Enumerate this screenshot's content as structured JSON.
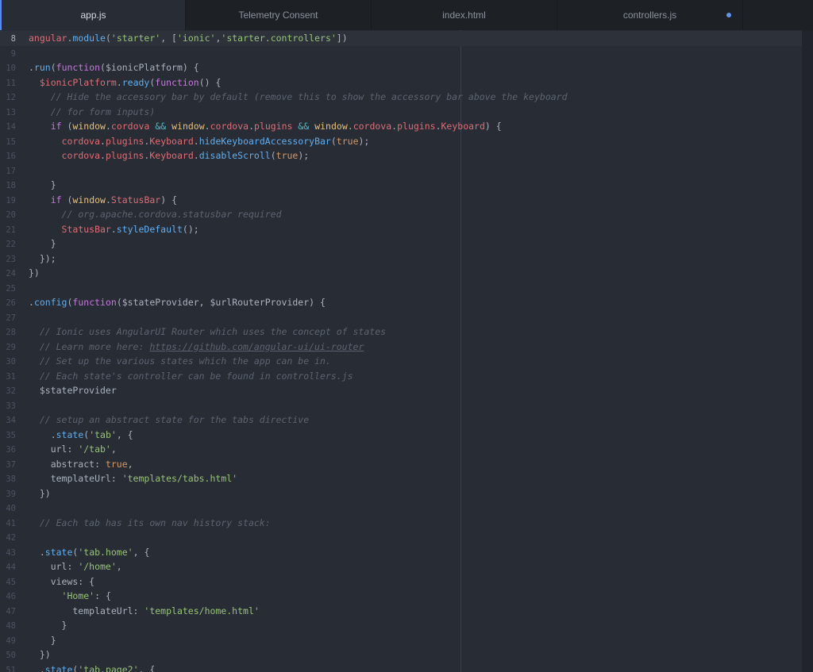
{
  "tabs": [
    {
      "label": "app.js",
      "active": true,
      "modified": false
    },
    {
      "label": "Telemetry Consent",
      "active": false,
      "modified": false
    },
    {
      "label": "index.html",
      "active": false,
      "modified": false
    },
    {
      "label": "controllers.js",
      "active": false,
      "modified": true
    }
  ],
  "colors": {
    "background": "#282c34",
    "tab_bar": "#1d2025",
    "accent": "#528bff",
    "modified_dot": "#6494ed"
  },
  "editor": {
    "cursor_line": 8,
    "lines": [
      {
        "n": 8,
        "tokens": [
          [
            "v",
            "angular"
          ],
          [
            "p",
            "."
          ],
          [
            "f",
            "module"
          ],
          [
            "p",
            "("
          ],
          [
            "s",
            "'starter'"
          ],
          [
            "p",
            ", ["
          ],
          [
            "s",
            "'ionic'"
          ],
          [
            "p",
            ","
          ],
          [
            "s",
            "'starter.controllers'"
          ],
          [
            "p",
            "])"
          ]
        ]
      },
      {
        "n": 9,
        "tokens": []
      },
      {
        "n": 10,
        "tokens": [
          [
            "p",
            "."
          ],
          [
            "f",
            "run"
          ],
          [
            "p",
            "("
          ],
          [
            "k",
            "function"
          ],
          [
            "p",
            "($ionicPlatform) {"
          ]
        ]
      },
      {
        "n": 11,
        "tokens": [
          [
            "p",
            "  "
          ],
          [
            "v",
            "$ionicPlatform"
          ],
          [
            "p",
            "."
          ],
          [
            "f",
            "ready"
          ],
          [
            "p",
            "("
          ],
          [
            "k",
            "function"
          ],
          [
            "p",
            "() {"
          ]
        ]
      },
      {
        "n": 12,
        "tokens": [
          [
            "p",
            "    "
          ],
          [
            "c",
            "// Hide the accessory bar by default (remove this to show the accessory bar above the keyboard"
          ]
        ]
      },
      {
        "n": 13,
        "tokens": [
          [
            "p",
            "    "
          ],
          [
            "c",
            "// for form inputs)"
          ]
        ]
      },
      {
        "n": 14,
        "tokens": [
          [
            "p",
            "    "
          ],
          [
            "k",
            "if"
          ],
          [
            "p",
            " ("
          ],
          [
            "cl",
            "window"
          ],
          [
            "p",
            "."
          ],
          [
            "v",
            "cordova"
          ],
          [
            "p",
            " "
          ],
          [
            "o",
            "&&"
          ],
          [
            "p",
            " "
          ],
          [
            "cl",
            "window"
          ],
          [
            "p",
            "."
          ],
          [
            "v",
            "cordova"
          ],
          [
            "p",
            "."
          ],
          [
            "v",
            "plugins"
          ],
          [
            "p",
            " "
          ],
          [
            "o",
            "&&"
          ],
          [
            "p",
            " "
          ],
          [
            "cl",
            "window"
          ],
          [
            "p",
            "."
          ],
          [
            "v",
            "cordova"
          ],
          [
            "p",
            "."
          ],
          [
            "v",
            "plugins"
          ],
          [
            "p",
            "."
          ],
          [
            "v",
            "Keyboard"
          ],
          [
            "p",
            ") {"
          ]
        ]
      },
      {
        "n": 15,
        "tokens": [
          [
            "p",
            "      "
          ],
          [
            "v",
            "cordova"
          ],
          [
            "p",
            "."
          ],
          [
            "v",
            "plugins"
          ],
          [
            "p",
            "."
          ],
          [
            "v",
            "Keyboard"
          ],
          [
            "p",
            "."
          ],
          [
            "f",
            "hideKeyboardAccessoryBar"
          ],
          [
            "p",
            "("
          ],
          [
            "n",
            "true"
          ],
          [
            "p",
            ");"
          ]
        ]
      },
      {
        "n": 16,
        "tokens": [
          [
            "p",
            "      "
          ],
          [
            "v",
            "cordova"
          ],
          [
            "p",
            "."
          ],
          [
            "v",
            "plugins"
          ],
          [
            "p",
            "."
          ],
          [
            "v",
            "Keyboard"
          ],
          [
            "p",
            "."
          ],
          [
            "f",
            "disableScroll"
          ],
          [
            "p",
            "("
          ],
          [
            "n",
            "true"
          ],
          [
            "p",
            ");"
          ]
        ]
      },
      {
        "n": 17,
        "tokens": []
      },
      {
        "n": 18,
        "tokens": [
          [
            "p",
            "    }"
          ]
        ]
      },
      {
        "n": 19,
        "tokens": [
          [
            "p",
            "    "
          ],
          [
            "k",
            "if"
          ],
          [
            "p",
            " ("
          ],
          [
            "cl",
            "window"
          ],
          [
            "p",
            "."
          ],
          [
            "v",
            "StatusBar"
          ],
          [
            "p",
            ") {"
          ]
        ]
      },
      {
        "n": 20,
        "tokens": [
          [
            "p",
            "      "
          ],
          [
            "c",
            "// org.apache.cordova.statusbar required"
          ]
        ]
      },
      {
        "n": 21,
        "tokens": [
          [
            "p",
            "      "
          ],
          [
            "v",
            "StatusBar"
          ],
          [
            "p",
            "."
          ],
          [
            "f",
            "styleDefault"
          ],
          [
            "p",
            "();"
          ]
        ]
      },
      {
        "n": 22,
        "tokens": [
          [
            "p",
            "    }"
          ]
        ]
      },
      {
        "n": 23,
        "tokens": [
          [
            "p",
            "  });"
          ]
        ]
      },
      {
        "n": 24,
        "tokens": [
          [
            "p",
            "})"
          ]
        ]
      },
      {
        "n": 25,
        "tokens": []
      },
      {
        "n": 26,
        "tokens": [
          [
            "p",
            "."
          ],
          [
            "f",
            "config"
          ],
          [
            "p",
            "("
          ],
          [
            "k",
            "function"
          ],
          [
            "p",
            "($stateProvider, $urlRouterProvider) {"
          ]
        ]
      },
      {
        "n": 27,
        "tokens": []
      },
      {
        "n": 28,
        "tokens": [
          [
            "p",
            "  "
          ],
          [
            "c",
            "// Ionic uses AngularUI Router which uses the concept of states"
          ]
        ]
      },
      {
        "n": 29,
        "tokens": [
          [
            "p",
            "  "
          ],
          [
            "c",
            "// Learn more here: "
          ],
          [
            "u",
            "https://github.com/angular-ui/ui-router"
          ]
        ]
      },
      {
        "n": 30,
        "tokens": [
          [
            "p",
            "  "
          ],
          [
            "c",
            "// Set up the various states which the app can be in."
          ]
        ]
      },
      {
        "n": 31,
        "tokens": [
          [
            "p",
            "  "
          ],
          [
            "c",
            "// Each state's controller can be found in controllers.js"
          ]
        ]
      },
      {
        "n": 32,
        "tokens": [
          [
            "p",
            "  $stateProvider"
          ]
        ]
      },
      {
        "n": 33,
        "tokens": []
      },
      {
        "n": 34,
        "tokens": [
          [
            "p",
            "  "
          ],
          [
            "c",
            "// setup an abstract state for the tabs directive"
          ]
        ]
      },
      {
        "n": 35,
        "tokens": [
          [
            "p",
            "    ."
          ],
          [
            "f",
            "state"
          ],
          [
            "p",
            "("
          ],
          [
            "s",
            "'tab'"
          ],
          [
            "p",
            ", {"
          ]
        ]
      },
      {
        "n": 36,
        "tokens": [
          [
            "p",
            "    url: "
          ],
          [
            "s",
            "'/tab'"
          ],
          [
            "p",
            ","
          ]
        ]
      },
      {
        "n": 37,
        "tokens": [
          [
            "p",
            "    abstract: "
          ],
          [
            "n",
            "true"
          ],
          [
            "p",
            ","
          ]
        ]
      },
      {
        "n": 38,
        "tokens": [
          [
            "p",
            "    templateUrl: "
          ],
          [
            "s",
            "'templates/tabs.html'"
          ]
        ]
      },
      {
        "n": 39,
        "tokens": [
          [
            "p",
            "  })"
          ]
        ]
      },
      {
        "n": 40,
        "tokens": []
      },
      {
        "n": 41,
        "tokens": [
          [
            "p",
            "  "
          ],
          [
            "c",
            "// Each tab has its own nav history stack:"
          ]
        ]
      },
      {
        "n": 42,
        "tokens": []
      },
      {
        "n": 43,
        "tokens": [
          [
            "p",
            "  ."
          ],
          [
            "f",
            "state"
          ],
          [
            "p",
            "("
          ],
          [
            "s",
            "'tab.home'"
          ],
          [
            "p",
            ", {"
          ]
        ]
      },
      {
        "n": 44,
        "tokens": [
          [
            "p",
            "    url: "
          ],
          [
            "s",
            "'/home'"
          ],
          [
            "p",
            ","
          ]
        ]
      },
      {
        "n": 45,
        "tokens": [
          [
            "p",
            "    views: {"
          ]
        ]
      },
      {
        "n": 46,
        "tokens": [
          [
            "p",
            "      "
          ],
          [
            "s",
            "'Home'"
          ],
          [
            "p",
            ": {"
          ]
        ]
      },
      {
        "n": 47,
        "tokens": [
          [
            "p",
            "        templateUrl: "
          ],
          [
            "s",
            "'templates/home.html'"
          ]
        ]
      },
      {
        "n": 48,
        "tokens": [
          [
            "p",
            "      }"
          ]
        ]
      },
      {
        "n": 49,
        "tokens": [
          [
            "p",
            "    }"
          ]
        ]
      },
      {
        "n": 50,
        "tokens": [
          [
            "p",
            "  })"
          ]
        ]
      },
      {
        "n": 51,
        "tokens": [
          [
            "p",
            "  ."
          ],
          [
            "f",
            "state"
          ],
          [
            "p",
            "("
          ],
          [
            "s",
            "'tab.page2'"
          ],
          [
            "p",
            ", {"
          ]
        ]
      }
    ]
  }
}
